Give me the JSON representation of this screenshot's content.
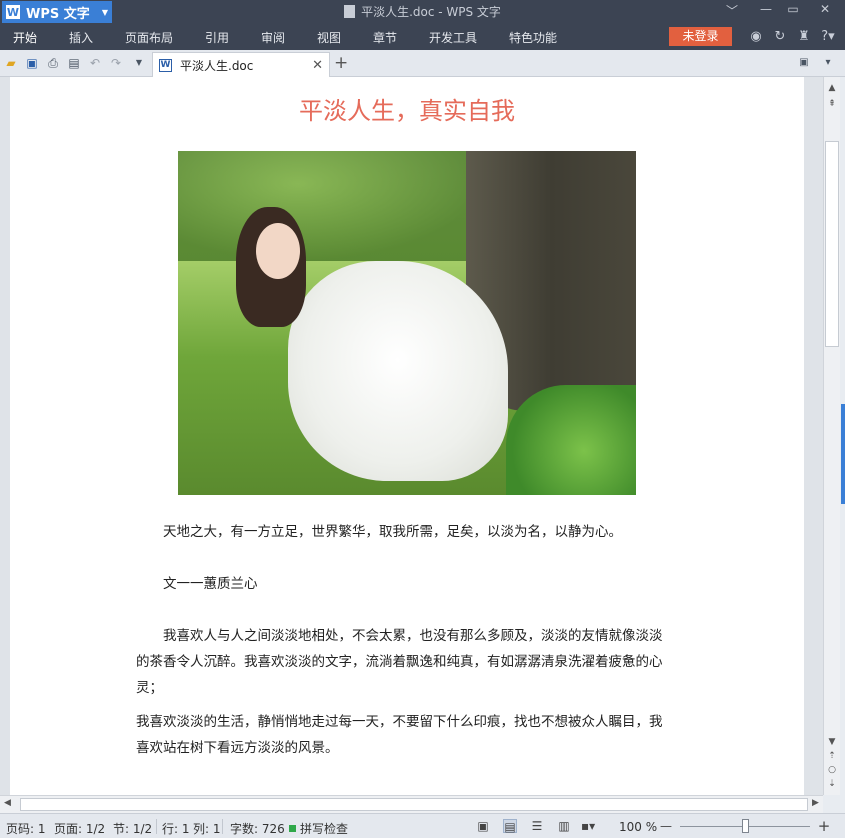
{
  "titlebar": {
    "app_button": "WPS 文字",
    "window_title": "平淡人生.doc - WPS 文字"
  },
  "menubar": {
    "items": [
      "开始",
      "插入",
      "页面布局",
      "引用",
      "审阅",
      "视图",
      "章节",
      "开发工具",
      "特色功能"
    ],
    "login": "未登录"
  },
  "tabs": {
    "doc_name": "平淡人生.doc"
  },
  "document": {
    "title": "平淡人生，真实自我",
    "paragraphs": [
      "天地之大，有一方立足，世界繁华，取我所需，足矣，以淡为名，以静为心。",
      "文一一蕙质兰心",
      "我喜欢人与人之间淡淡地相处，不会太累，也没有那么多顾及，淡淡的友情就像淡淡的茶香令人沉醉。我喜欢淡淡的文字，流淌着飘逸和纯真，有如潺潺清泉洗濯着疲惫的心灵；",
      "我喜欢淡淡的生活，静悄悄地走过每一天，不要留下什么印痕，找也不想被众人瞩目，我喜欢站在树下看远方淡淡的风景。"
    ]
  },
  "statusbar": {
    "page_code": "页码: 1",
    "page": "页面: 1/2",
    "section": "节: 1/2",
    "row": "行: 1",
    "col": "列: 1",
    "word_count": "字数: 726",
    "spell_check": "拼写检查",
    "zoom": "100 %"
  },
  "icons": {
    "minimize": "minimize-icon",
    "maximize": "maximize-icon",
    "close": "close-icon"
  },
  "colors": {
    "title_red": "#e56b5a",
    "wps_blue": "#3a7fd6",
    "login_orange": "#e2603f"
  }
}
